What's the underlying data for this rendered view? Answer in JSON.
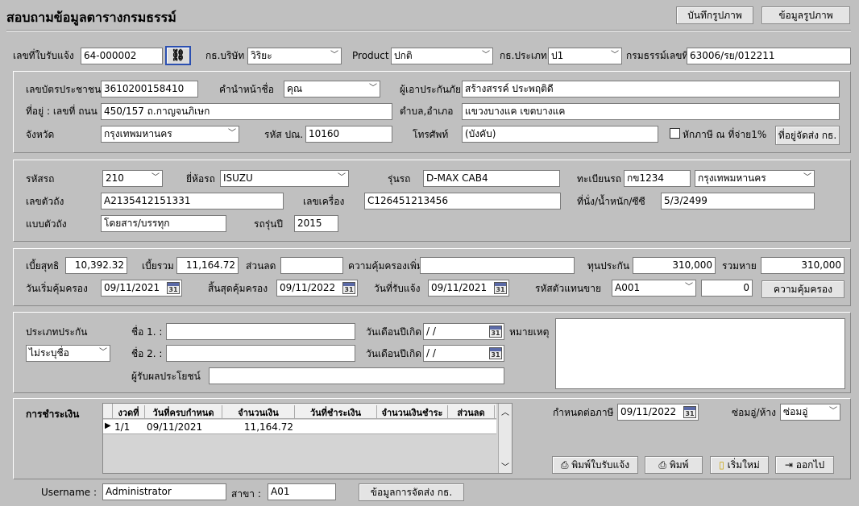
{
  "header": {
    "title": "สอบถามข้อมูลตารางกรมธรรม์",
    "btn_save_image": "บันทึกรูปภาพ",
    "btn_image_info": "ข้อมูลรูปภาพ"
  },
  "topbar": {
    "notice_no_label": "เลขที่ใบรับแจ้ง",
    "notice_no": "64-000002",
    "company_label": "กธ.บริษัท",
    "company": "วิริยะ",
    "product_label": "Product",
    "product": "ปกติ",
    "type_label": "กธ.ประเภท",
    "type": "ป1",
    "policy_no_label": "กรมธรรม์เลขที่",
    "policy_no": "63006/รย/012211"
  },
  "insured": {
    "id_label": "เลขบัตรประชาชน",
    "id": "3610200158410",
    "prefix_label": "คำนำหน้าชื่อ",
    "prefix": "คุณ",
    "name_label": "ผู้เอาประกันภัย",
    "name": "สร้างสรรค์  ประพฤติดี",
    "address_label": "ที่อยู่ : เลขที่ ถนน",
    "address": "450/157 ถ.กาญจนภิเษก",
    "district_label": "ตำบล,อำเภอ",
    "district": "แขวงบางแค เขตบางแค",
    "province_label": "จังหวัด",
    "province": "กรุงเทพมหานคร",
    "postcode_label": "รหัส ปณ.",
    "postcode": "10160",
    "phone_label": "โทรศัพท์",
    "phone": "(บังคับ)",
    "tax_label": "หักภาษี ณ ที่จ่าย1%",
    "btn_delivery": "ที่อยู่จัดส่ง กธ."
  },
  "vehicle": {
    "code_label": "รหัสรถ",
    "code": "210",
    "brand_label": "ยี่ห้อรถ",
    "brand": "ISUZU",
    "model_label": "รุ่นรถ",
    "model": "D-MAX CAB4",
    "plate_label": "ทะเบียนรถ",
    "plate": "กข1234",
    "plate_province": "กรุงเทพมหานคร",
    "chassis_label": "เลขตัวถัง",
    "chassis": "A2135412151331",
    "engine_label": "เลขเครื่อง",
    "engine": "C126451213456",
    "seats_label": "ที่นั่ง/น้ำหนัก/ซีซี",
    "seats": "5/3/2499",
    "body_label": "แบบตัวถัง",
    "body": "โดยสาร/บรรทุก",
    "year_label": "รถรุ่นปี",
    "year": "2015"
  },
  "premium": {
    "net_label": "เบี้ยสุทธิ",
    "net": "10,392.32",
    "total_label": "เบี้ยรวม",
    "total": "11,164.72",
    "discount_label": "ส่วนลด",
    "discount": "",
    "extra_label": "ความคุ้มครองเพิ่ม",
    "extra": "",
    "sum_label": "ทุนประกัน",
    "sum": "310,000",
    "loss_label": "รวมหาย",
    "loss": "310,000",
    "start_label": "วันเริ่มคุ้มครอง",
    "start": "09/11/2021",
    "end_label": "สิ้นสุดคุ้มครอง",
    "end": "09/11/2022",
    "notice_date_label": "วันที่รับแจ้ง",
    "notice_date": "09/11/2021",
    "agent_label": "รหัสตัวแทนขาย",
    "agent": "A001",
    "agent_val": "0",
    "btn_coverage": "ความคุ้มครอง"
  },
  "beneficiary": {
    "type_label": "ประเภทประกัน",
    "type": "ไม่ระบุชื่อ",
    "name1_label": "ชื่อ 1. :",
    "name1": "",
    "name2_label": "ชื่อ 2. :",
    "name2": "",
    "dob_label": "วันเดือนปีเกิด",
    "dob1": " / /",
    "dob2": " / /",
    "note_label": "หมายเหตุ",
    "receiver_label": "ผู้รับผลประโยชน์"
  },
  "payment": {
    "label": "การชำระเงิน",
    "columns": [
      "งวดที่",
      "วันที่ครบกำหนด",
      "จำนวนเงิน",
      "วันที่ชำระเงิน",
      "จำนวนเงินชำระ",
      "ส่วนลด"
    ],
    "rows": [
      {
        "no": "1/1",
        "due": "09/11/2021",
        "amount": "11,164.72",
        "paid_date": "",
        "paid": "",
        "discount": ""
      }
    ],
    "tax_due_label": "กำหนดต่อภาษี",
    "tax_due": "09/11/2022",
    "repair_label": "ซ่อมอู่/ห้าง",
    "repair": "ซ่อมอู่",
    "btn_print_notice": "พิมพ์ใบรับแจ้ง",
    "btn_print": "พิมพ์",
    "btn_new": "เริ่มใหม่",
    "btn_exit": "ออกไป"
  },
  "footer": {
    "username_label": "Username :",
    "username": "Administrator",
    "branch_label": "สาขา :",
    "branch": "A01",
    "btn_delivery_info": "ข้อมูลการจัดส่ง กธ."
  }
}
